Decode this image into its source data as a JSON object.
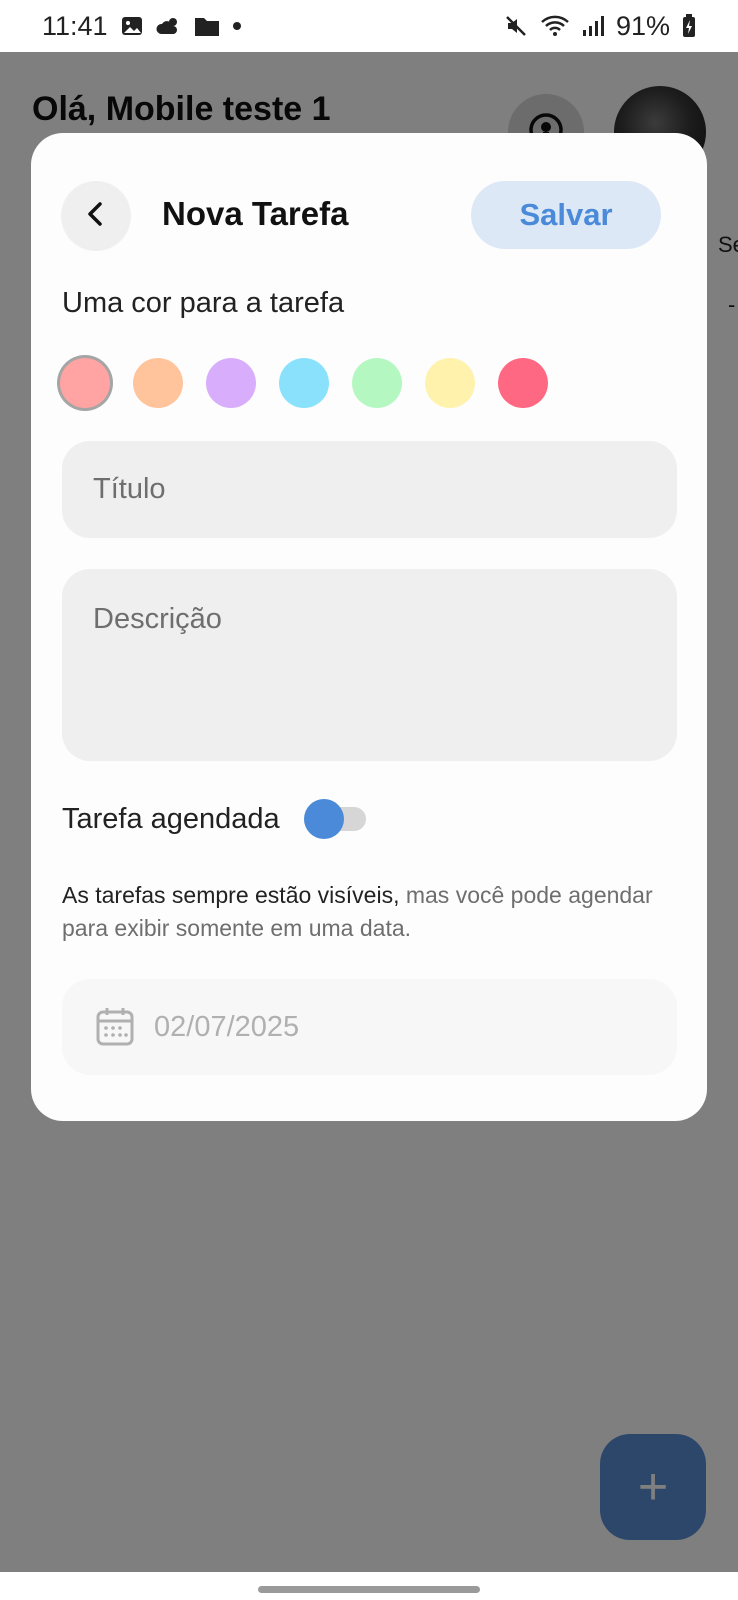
{
  "status_bar": {
    "time": "11:41",
    "battery": "91%",
    "icons": [
      "gallery-icon",
      "weather-icon",
      "folder-icon",
      "dot-icon",
      "mute-icon",
      "wifi-icon",
      "signal-icon",
      "battery-charging-icon"
    ]
  },
  "background": {
    "greeting": "Olá, Mobile teste 1",
    "side_text": "Se",
    "side_mark": "-",
    "fab_label": "+"
  },
  "modal": {
    "title": "Nova Tarefa",
    "save_label": "Salvar",
    "color_label": "Uma cor para a tarefa",
    "colors": [
      {
        "name": "red-light",
        "hex": "#ffa3a3",
        "selected": true
      },
      {
        "name": "orange-light",
        "hex": "#ffc49c"
      },
      {
        "name": "purple-light",
        "hex": "#d8aefc"
      },
      {
        "name": "blue-light",
        "hex": "#8ae1fb"
      },
      {
        "name": "green-light",
        "hex": "#b4f7c1"
      },
      {
        "name": "yellow-light",
        "hex": "#fff2ad"
      },
      {
        "name": "pink-red",
        "hex": "#ff6883"
      }
    ],
    "title_placeholder": "Título",
    "description_placeholder": "Descrição",
    "scheduled_label": "Tarefa agendada",
    "scheduled_on": false,
    "info_text_main": "As tarefas sempre estão visíveis,",
    "info_text_muted": "mas você pode agendar para exibir somente em uma data.",
    "date_value": "02/07/2025"
  },
  "colors": {
    "accent": "#4a8ad8",
    "save_bg": "#dde8f7",
    "field_bg": "#efefef"
  }
}
